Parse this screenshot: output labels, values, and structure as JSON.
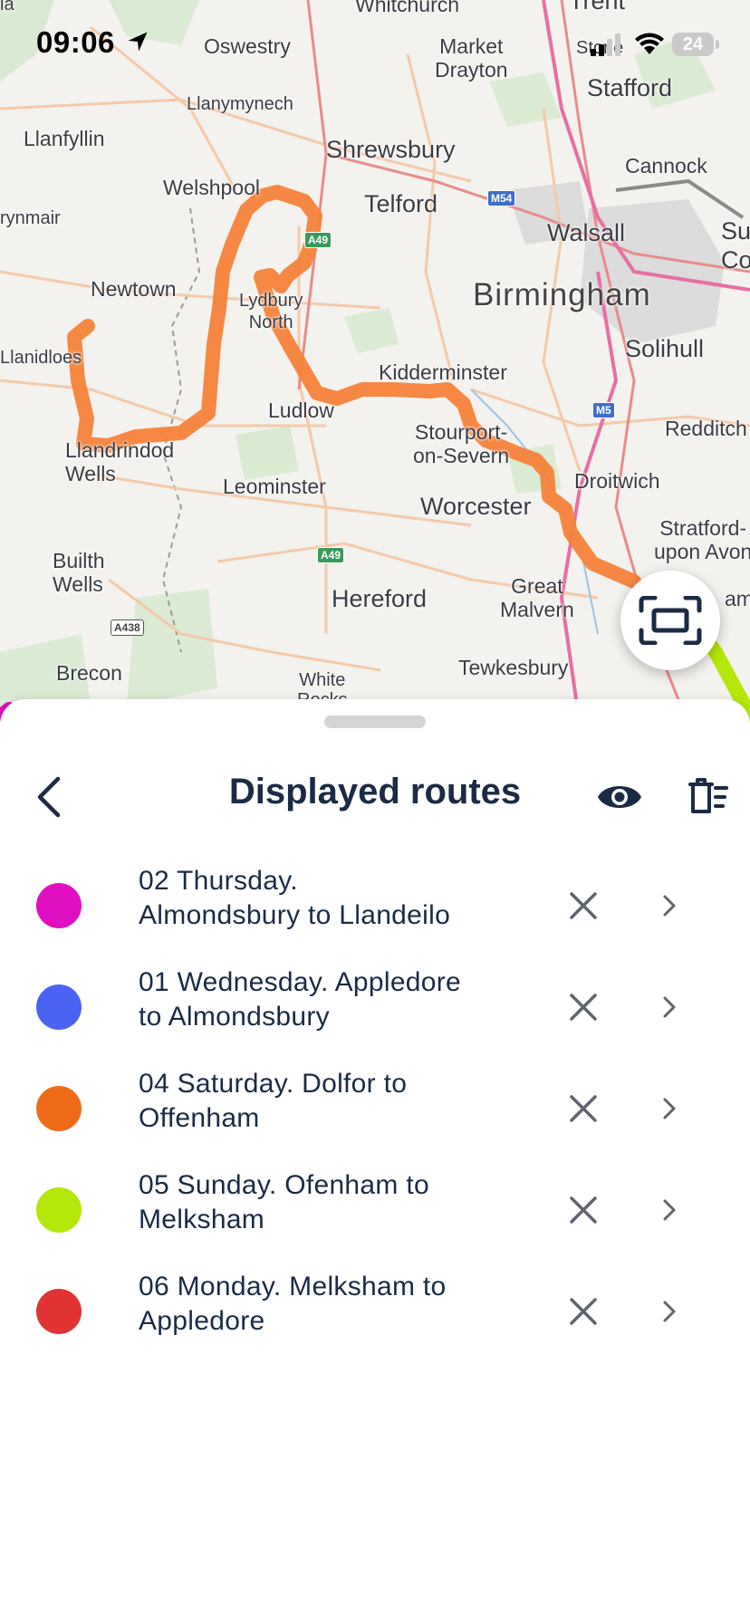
{
  "status_bar": {
    "time": "09:06",
    "battery": "24"
  },
  "map": {
    "places": [
      {
        "name": "Whitchurch",
        "cls": "md"
      },
      {
        "name": "Trent",
        "cls": "lg"
      },
      {
        "name": "Oswestry",
        "cls": "md"
      },
      {
        "name": "Market\nDrayton",
        "cls": "md"
      },
      {
        "name": "Stone",
        "cls": "sm"
      },
      {
        "name": "Stafford",
        "cls": "lg"
      },
      {
        "name": "Llanymynech",
        "cls": "sm"
      },
      {
        "name": "Llanfyllin",
        "cls": "md"
      },
      {
        "name": "Shrewsbury",
        "cls": "lg"
      },
      {
        "name": "Cannock",
        "cls": "md"
      },
      {
        "name": "Welshpool",
        "cls": "md"
      },
      {
        "name": "Telford",
        "cls": "lg"
      },
      {
        "name": "Walsall",
        "cls": "lg"
      },
      {
        "name": "Su",
        "cls": "lg"
      },
      {
        "name": "Co",
        "cls": "lg"
      },
      {
        "name": "rynmair",
        "cls": "sm"
      },
      {
        "name": "Newtown",
        "cls": "md"
      },
      {
        "name": "Lydbury\nNorth",
        "cls": "sm"
      },
      {
        "name": "Birmingham",
        "cls": "xl"
      },
      {
        "name": "Solihull",
        "cls": "lg"
      },
      {
        "name": "Llanidloes",
        "cls": "sm"
      },
      {
        "name": "Kidderminster",
        "cls": "md"
      },
      {
        "name": "Ludlow",
        "cls": "md"
      },
      {
        "name": "Redditch",
        "cls": "md"
      },
      {
        "name": "Stourport-\non-Severn",
        "cls": "md"
      },
      {
        "name": "Llandrindod\nWells",
        "cls": "md"
      },
      {
        "name": "Droitwich",
        "cls": "md"
      },
      {
        "name": "Leominster",
        "cls": "md"
      },
      {
        "name": "Worcester",
        "cls": "lg"
      },
      {
        "name": "Builth\nWells",
        "cls": "md"
      },
      {
        "name": "Stratford-\nupon Avon",
        "cls": "md"
      },
      {
        "name": "Great\nMalvern",
        "cls": "md"
      },
      {
        "name": "Hereford",
        "cls": "lg"
      },
      {
        "name": "Brecon",
        "cls": "md"
      },
      {
        "name": "Tewkesbury",
        "cls": "md"
      },
      {
        "name": "White\nRocks",
        "cls": "sm"
      },
      {
        "name": "am",
        "cls": "md"
      },
      {
        "name": "la",
        "cls": "sm"
      }
    ],
    "shields": [
      "A49",
      "M54",
      "A49",
      "M5",
      "A438"
    ]
  },
  "fab": {
    "icon": "fit-bounds-icon"
  },
  "sheet": {
    "title": "Displayed routes",
    "routes": [
      {
        "name": "02 Thursday.\nAlmondsbury to Llandeilo",
        "color": "#e00fc0"
      },
      {
        "name": "01 Wednesday. Appledore\nto Almondsbury",
        "color": "#4a63f2"
      },
      {
        "name": "04 Saturday. Dolfor to\nOffenham",
        "color": "#ef6b1a"
      },
      {
        "name": "05 Sunday. Ofenham to\nMelksham",
        "color": "#b3e80a"
      },
      {
        "name": "06 Monday. Melksham to\nAppledore",
        "color": "#e03333"
      }
    ]
  },
  "colors": {
    "route_orange": "#f5823a",
    "text_dark": "#1b2b45"
  }
}
